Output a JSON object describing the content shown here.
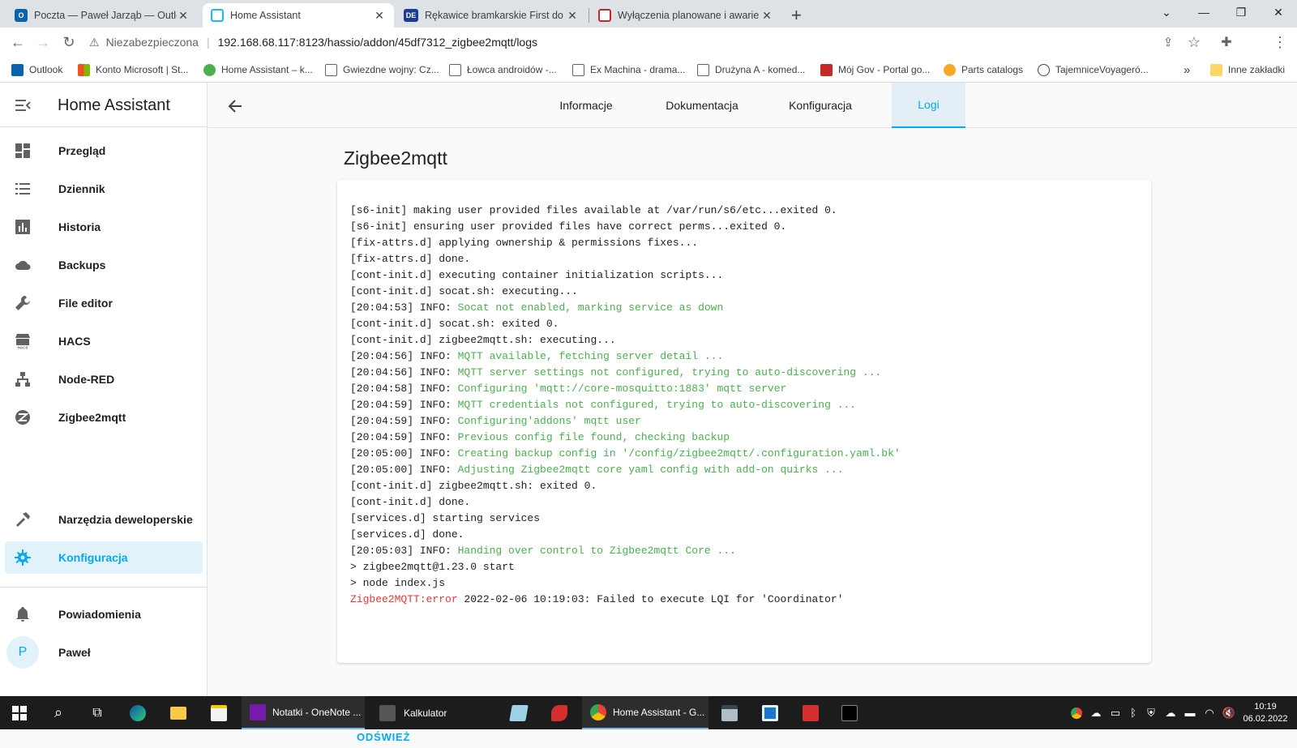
{
  "browser": {
    "tabs": [
      {
        "title": "Poczta — Paweł Jarząb — Outlo",
        "favicon": "O",
        "color": "#0a64ad"
      },
      {
        "title": "Home Assistant",
        "favicon": "",
        "color": "#18bcf2"
      },
      {
        "title": "Rękawice bramkarskie First do pi",
        "favicon": "DE",
        "color": "#1a3d8f"
      },
      {
        "title": "Wyłączenia planowane i awarie |",
        "favicon": "",
        "color": "#c62828"
      }
    ],
    "security_label": "Niezabezpieczona",
    "url": "192.168.68.117:8123/hassio/addon/45df7312_zigbee2mqtt/logs",
    "profile_initial": "P",
    "bookmarks": [
      {
        "label": "Outlook",
        "color": "#0a64ad"
      },
      {
        "label": "Konto Microsoft | St...",
        "color": "#f25022"
      },
      {
        "label": "Home Assistant – k...",
        "color": "#4caf50"
      },
      {
        "label": "Gwiezdne wojny: Cz...",
        "color": "#5f6368"
      },
      {
        "label": "Łowca androidów -...",
        "color": "#5f6368"
      },
      {
        "label": "Ex Machina - drama...",
        "color": "#5f6368"
      },
      {
        "label": "Drużyna A - komed...",
        "color": "#5f6368"
      },
      {
        "label": "Mój Gov - Portal go...",
        "color": "#c62828"
      },
      {
        "label": "Parts catalogs",
        "color": "#f9a825"
      },
      {
        "label": "TajemniceVoyageró...",
        "color": "#444"
      }
    ],
    "other_bookmarks": "Inne zakładki",
    "more_bookmarks": "»"
  },
  "sidebar": {
    "title": "Home Assistant",
    "items": [
      {
        "label": "Przegląd",
        "icon": "dashboard-icon"
      },
      {
        "label": "Dziennik",
        "icon": "logbook-icon"
      },
      {
        "label": "Historia",
        "icon": "history-chart-icon"
      },
      {
        "label": "Backups",
        "icon": "cloud-icon"
      },
      {
        "label": "File editor",
        "icon": "wrench-icon"
      },
      {
        "label": "HACS",
        "icon": "hacs-icon"
      },
      {
        "label": "Node-RED",
        "icon": "sitemap-icon"
      },
      {
        "label": "Zigbee2mqtt",
        "icon": "zigbee-icon"
      }
    ],
    "dev_tools": "Narzędzia deweloperskie",
    "config": "Konfiguracja",
    "notifications": "Powiadomienia",
    "user_name": "Paweł",
    "user_initial": "P"
  },
  "page": {
    "tabs": [
      "Informacje",
      "Dokumentacja",
      "Konfiguracja",
      "Logi"
    ],
    "active_tab": "Logi",
    "title": "Zigbee2mqtt",
    "refresh_button": "ODŚWIEŻ",
    "log_lines": [
      {
        "prefix": "[s6-init] making user provided files available at /var/run/s6/etc...exited 0.",
        "msg": "",
        "cls": ""
      },
      {
        "prefix": "[s6-init] ensuring user provided files have correct perms...exited 0.",
        "msg": "",
        "cls": ""
      },
      {
        "prefix": "[fix-attrs.d] applying ownership & permissions fixes...",
        "msg": "",
        "cls": ""
      },
      {
        "prefix": "[fix-attrs.d] done.",
        "msg": "",
        "cls": ""
      },
      {
        "prefix": "[cont-init.d] executing container initialization scripts...",
        "msg": "",
        "cls": ""
      },
      {
        "prefix": "[cont-init.d] socat.sh: executing...",
        "msg": "",
        "cls": ""
      },
      {
        "prefix": "[20:04:53] INFO: ",
        "msg": "Socat not enabled, marking service as down",
        "cls": "g"
      },
      {
        "prefix": "[cont-init.d] socat.sh: exited 0.",
        "msg": "",
        "cls": ""
      },
      {
        "prefix": "[cont-init.d] zigbee2mqtt.sh: executing...",
        "msg": "",
        "cls": ""
      },
      {
        "prefix": "[20:04:56] INFO: ",
        "msg": "MQTT available, fetching server detail ...",
        "cls": "g"
      },
      {
        "prefix": "[20:04:56] INFO: ",
        "msg": "MQTT server settings not configured, trying to auto-discovering ...",
        "cls": "g"
      },
      {
        "prefix": "[20:04:58] INFO: ",
        "msg": "Configuring 'mqtt://core-mosquitto:1883' mqtt server",
        "cls": "g"
      },
      {
        "prefix": "[20:04:59] INFO: ",
        "msg": "MQTT credentials not configured, trying to auto-discovering ...",
        "cls": "g"
      },
      {
        "prefix": "[20:04:59] INFO: ",
        "msg": "Configuring'addons' mqtt user",
        "cls": "g"
      },
      {
        "prefix": "[20:04:59] INFO: ",
        "msg": "Previous config file found, checking backup",
        "cls": "g"
      },
      {
        "prefix": "[20:05:00] INFO: ",
        "msg": "Creating backup config in '/config/zigbee2mqtt/.configuration.yaml.bk'",
        "cls": "g"
      },
      {
        "prefix": "[20:05:00] INFO: ",
        "msg": "Adjusting Zigbee2mqtt core yaml config with add-on quirks ...",
        "cls": "g"
      },
      {
        "prefix": "[cont-init.d] zigbee2mqtt.sh: exited 0.",
        "msg": "",
        "cls": ""
      },
      {
        "prefix": "[cont-init.d] done.",
        "msg": "",
        "cls": ""
      },
      {
        "prefix": "[services.d] starting services",
        "msg": "",
        "cls": ""
      },
      {
        "prefix": "[services.d] done.",
        "msg": "",
        "cls": ""
      },
      {
        "prefix": "[20:05:03] INFO: ",
        "msg": "Handing over control to Zigbee2mqtt Core ...",
        "cls": "g"
      },
      {
        "prefix": "> zigbee2mqtt@1.23.0 start",
        "msg": "",
        "cls": ""
      },
      {
        "prefix": "> node index.js",
        "msg": "",
        "cls": ""
      },
      {
        "prefix": "Zigbee2MQTT:error",
        "msg": " 2022-02-06 10:19:03: Failed to execute LQI for 'Coordinator'",
        "cls": "err"
      }
    ]
  },
  "taskbar": {
    "apps": [
      {
        "label": "Notatki - OneNote ...",
        "color": "#7719aa"
      },
      {
        "label": "Kalkulator",
        "color": "#555"
      },
      {
        "label": "Home Assistant - G...",
        "color": "#1a73e8"
      }
    ],
    "time": "10:19",
    "date": "06.02.2022"
  },
  "colors": {
    "accent": "#03a9f4",
    "log_info": "#4caf50",
    "log_error": "#e53935"
  }
}
